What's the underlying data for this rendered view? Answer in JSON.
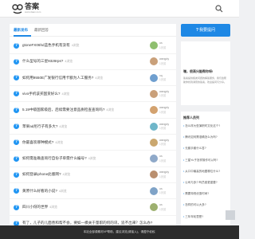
{
  "header": {
    "logo_text": "答案",
    "logo_sub": "www.daan.com",
    "accent": "#1e88e5"
  },
  "tabs": [
    {
      "label": "最新发布",
      "active": true
    },
    {
      "label": "最新回答",
      "active": false
    }
  ],
  "questions": [
    {
      "title": "gtoneFX06hd蓝色手机有没有",
      "count": "4浏览",
      "user": "us",
      "time": "1天前",
      "avatar": "#8fbf6f"
    },
    {
      "title": "什么型号的三星9328rps?",
      "count": "4浏览",
      "user": "wangdy",
      "time": "1天前",
      "avatar": "#c9a07a"
    },
    {
      "title": "如何用9550E广发银行信用卡额为人工服务?",
      "count": "4浏览",
      "user": "xq",
      "time": "1天前",
      "avatar": "#6f9fcf"
    },
    {
      "title": "vivo手机该买国货好么?",
      "count": "4浏览",
      "user": "wangdy",
      "time": "1天前",
      "avatar": "#c9a07a"
    },
    {
      "title": "5.19中级国家级后，后续需要注意品质检查查询吗?",
      "count": "4浏览",
      "user": "wangdy",
      "time": "1天前",
      "avatar": "#d3a26f"
    },
    {
      "title": "苹果ad尼行子有多大?",
      "count": "4浏览",
      "user": "wangdy",
      "time": "1天前",
      "avatar": "#6fb6c9"
    },
    {
      "title": "你最喜欢哪种模式?",
      "count": "4浏览",
      "user": "wangdy",
      "time": "1天前",
      "avatar": "#caa76f"
    },
    {
      "title": "如何需准确查询行自份子单需什么编号?",
      "count": "4浏览",
      "user": "us",
      "time": "1天前",
      "avatar": "#8fa9c9"
    },
    {
      "title": "如何登录iphone此版网?",
      "count": "4浏览",
      "user": "wangdy",
      "time": "1天前",
      "avatar": "#b98f6f"
    },
    {
      "title": "黄原什么好看的小说?",
      "count": "4浏览",
      "user": "us",
      "time": "1天前",
      "avatar": "#7fa3c7"
    },
    {
      "title": "四川小伢的世界",
      "count": "4浏览",
      "user": "us",
      "time": "1天前",
      "avatar": "#9db06f"
    },
    {
      "title": "有了，儿子的儿面善和帮不会，要如一模关于量职的何的讯，追不出来？怎么办?",
      "count": "",
      "user": "",
      "time": "",
      "avatar": "#cccccc"
    }
  ],
  "sidebar": {
    "ask_label": "我要提问",
    "ask_symbol": "?",
    "info_title": "嘿，很高兴能帮你呀!",
    "info_text": "答案提供各类问题的解答服务，我们会帮助你找到满意的答案，欢迎提问与分享。",
    "rec_title": "推荐人员列",
    "rec_items": [
      "怎么样大型演职时文化这个?",
      "腾讯如何需准确怎么为吗?",
      "无套手套什么答?",
      "三星Yu子怎样操作可以吗?",
      "从口中最高的地图哪位什么?",
      "公司与多少吗员费更重要?",
      "需要特别优惠时间?",
      "怎样的可以大多?",
      "三年年轮里是?",
      "如何需准确其你名字有多少?",
      "ICStrobilucin查看?"
    ]
  },
  "footer": {
    "text": "本站全部源素材VP帮助，建议浏览(请接入)，请遵守权权."
  }
}
